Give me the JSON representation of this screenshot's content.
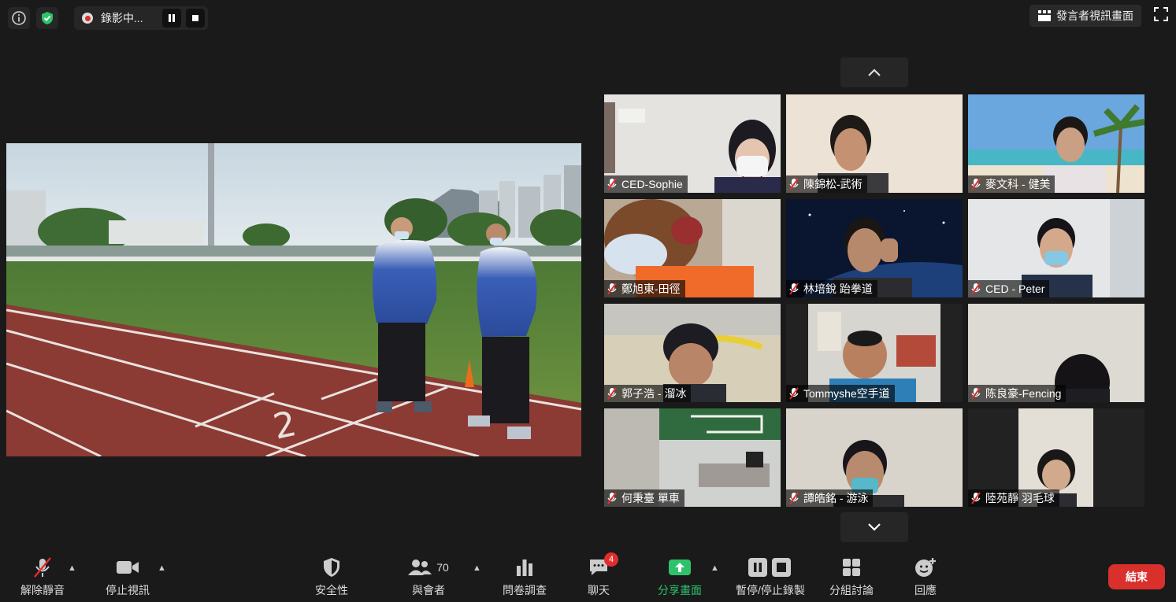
{
  "recording": {
    "label": "錄影中..."
  },
  "top": {
    "speaker_view_label": "發言者視訊畫面"
  },
  "participants": [
    {
      "name": "CED-Sophie"
    },
    {
      "name": "陳錦松-武術"
    },
    {
      "name": "麥文科 - 健美"
    },
    {
      "name": "鄭旭東-田徑"
    },
    {
      "name": "林培銳 跆拳道"
    },
    {
      "name": "CED - Peter"
    },
    {
      "name": "郭子浩 - 溜冰"
    },
    {
      "name": "Tommyshe空手道"
    },
    {
      "name": "陈良豪-Fencing"
    },
    {
      "name": "何秉臺 單車"
    },
    {
      "name": "譚皓銘 - 游泳"
    },
    {
      "name": "陸苑靜 羽毛球"
    }
  ],
  "toolbar": {
    "unmute": "解除靜音",
    "stop_video": "停止視訊",
    "security": "安全性",
    "participants": "與會者",
    "participants_count": "70",
    "polls": "問卷調查",
    "chat": "聊天",
    "chat_badge": "4",
    "share": "分享畫面",
    "pause_stop_rec": "暫停/停止錄製",
    "breakout": "分組討論",
    "reactions": "回應",
    "end": "結束"
  },
  "colors": {
    "share_green": "#2ec36b",
    "end_red": "#d9302c",
    "badge_red": "#e02d2d",
    "shield_green": "#2ec36b"
  }
}
